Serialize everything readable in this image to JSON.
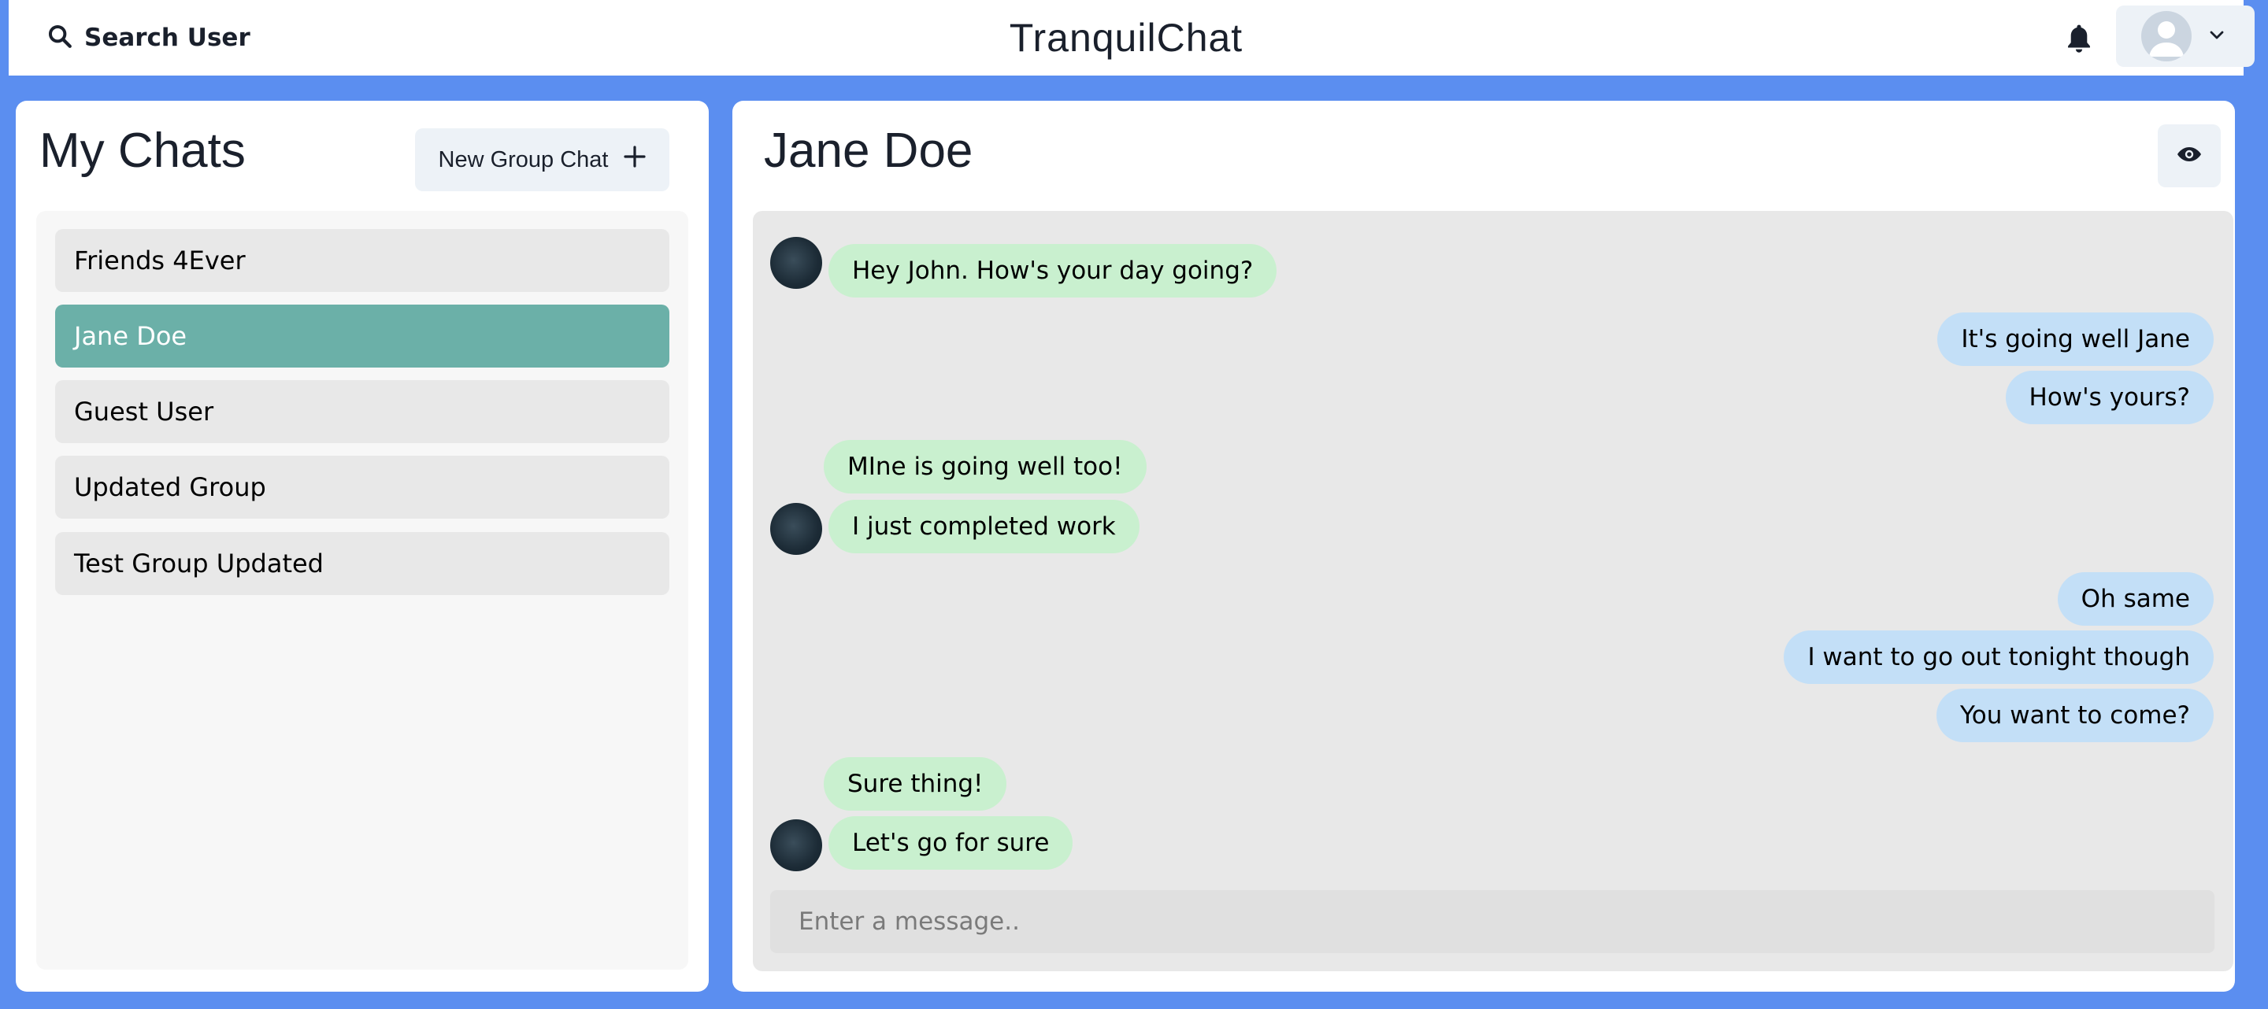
{
  "header": {
    "search_label": "Search User",
    "app_title": "TranquilChat",
    "bell_icon": "bell-icon",
    "profile_icon": "user-avatar-icon",
    "chevron_icon": "chevron-down-icon"
  },
  "sidebar": {
    "title": "My Chats",
    "new_group_label": "New Group Chat",
    "new_group_icon": "plus-icon",
    "chats": [
      {
        "label": "Friends 4Ever",
        "selected": false
      },
      {
        "label": "Jane Doe",
        "selected": true
      },
      {
        "label": "Guest User",
        "selected": false
      },
      {
        "label": "Updated Group",
        "selected": false
      },
      {
        "label": "Test Group Updated",
        "selected": false
      }
    ]
  },
  "chat": {
    "title": "Jane Doe",
    "view_icon": "eye-icon",
    "messages": [
      {
        "text": "Hey John. How's your day going?",
        "from": "them"
      },
      {
        "text": "It's going well Jane",
        "from": "me"
      },
      {
        "text": "How's yours?",
        "from": "me"
      },
      {
        "text": "MIne is going well too!",
        "from": "them"
      },
      {
        "text": "I just completed work",
        "from": "them"
      },
      {
        "text": "Oh same",
        "from": "me"
      },
      {
        "text": "I want to go out tonight though",
        "from": "me"
      },
      {
        "text": "You want to come?",
        "from": "me"
      },
      {
        "text": "Sure thing!",
        "from": "them"
      },
      {
        "text": "Let's go for sure",
        "from": "them"
      }
    ],
    "input_placeholder": "Enter a message.."
  },
  "colors": {
    "background": "#5b8ef0",
    "selected_chat": "#6bb0a8",
    "incoming_bubble": "#c9f0cf",
    "outgoing_bubble": "#c3dff7"
  }
}
